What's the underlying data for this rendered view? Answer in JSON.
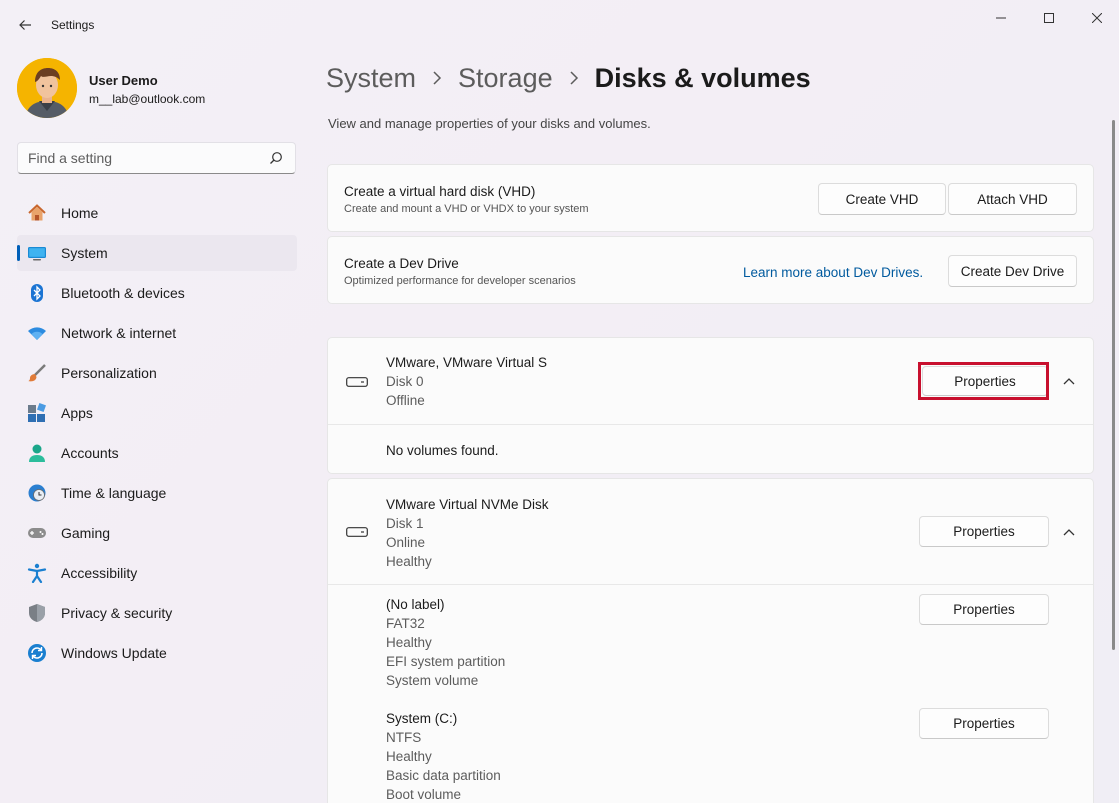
{
  "window": {
    "title": "Settings"
  },
  "profile": {
    "name": "User Demo",
    "email": "m__lab@outlook.com"
  },
  "search": {
    "placeholder": "Find a setting"
  },
  "sidebar": {
    "items": [
      {
        "label": "Home",
        "icon": "home-icon"
      },
      {
        "label": "System",
        "icon": "system-icon",
        "active": true
      },
      {
        "label": "Bluetooth & devices",
        "icon": "bluetooth-icon"
      },
      {
        "label": "Network & internet",
        "icon": "wifi-icon"
      },
      {
        "label": "Personalization",
        "icon": "brush-icon"
      },
      {
        "label": "Apps",
        "icon": "apps-icon"
      },
      {
        "label": "Accounts",
        "icon": "person-icon"
      },
      {
        "label": "Time & language",
        "icon": "clock-globe-icon"
      },
      {
        "label": "Gaming",
        "icon": "controller-icon"
      },
      {
        "label": "Accessibility",
        "icon": "accessibility-icon"
      },
      {
        "label": "Privacy & security",
        "icon": "shield-icon"
      },
      {
        "label": "Windows Update",
        "icon": "update-icon"
      }
    ]
  },
  "breadcrumb": {
    "items": [
      "System",
      "Storage"
    ],
    "current": "Disks & volumes"
  },
  "page": {
    "description": "View and manage properties of your disks and volumes."
  },
  "vhd_card": {
    "title": "Create a virtual hard disk (VHD)",
    "subtitle": "Create and mount a VHD or VHDX to your system",
    "create_button": "Create VHD",
    "attach_button": "Attach VHD"
  },
  "dev_drive_card": {
    "title": "Create a Dev Drive",
    "subtitle": "Optimized performance for developer scenarios",
    "learn_link": "Learn more about Dev Drives.",
    "create_button": "Create Dev Drive"
  },
  "disks": [
    {
      "name": "VMware, VMware Virtual S",
      "disk": "Disk 0",
      "status": "Offline",
      "properties_button": "Properties",
      "empty_message": "No volumes found."
    },
    {
      "name": "VMware Virtual NVMe Disk",
      "disk": "Disk 1",
      "status": "Online",
      "health": "Healthy",
      "properties_button": "Properties",
      "volumes": [
        {
          "label": "(No label)",
          "fs": "FAT32",
          "health": "Healthy",
          "type": "EFI system partition",
          "role": "System volume",
          "properties_button": "Properties"
        },
        {
          "label": "System (C:)",
          "fs": "NTFS",
          "health": "Healthy",
          "type": "Basic data partition",
          "role": "Boot volume",
          "properties_button": "Properties"
        }
      ]
    }
  ],
  "colors": {
    "accent": "#005fb8",
    "highlight": "#c8102e",
    "link": "#005a9e"
  }
}
